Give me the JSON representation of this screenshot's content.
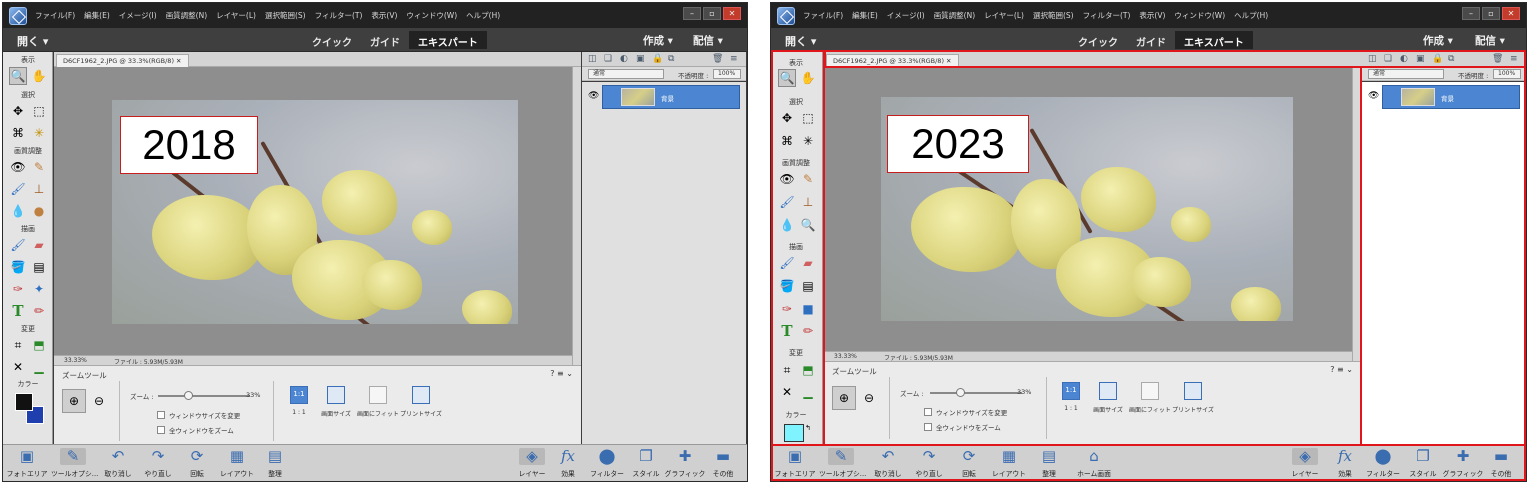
{
  "menu": [
    "ファイル(F)",
    "編集(E)",
    "イメージ(I)",
    "画質調整(N)",
    "レイヤー(L)",
    "選択範囲(S)",
    "フィルター(T)",
    "表示(V)",
    "ウィンドウ(W)",
    "ヘルプ(H)"
  ],
  "open_label": "開く",
  "modes": {
    "quick": "クイック",
    "guide": "ガイド",
    "expert": "エキスパート"
  },
  "create_label": "作成",
  "share_label": "配信",
  "doc_tab": "D6CF1962_2.JPG @ 33.3%(RGB/8)",
  "toolbox": {
    "view": "表示",
    "select": "選択",
    "enhance": "画質調整",
    "draw": "描画",
    "modify": "変更",
    "color": "カラー"
  },
  "icons": [
    "zoom-icon",
    "hand-icon",
    "move-icon",
    "marquee-icon",
    "lasso-icon",
    "magic-wand-icon",
    "red-eye-icon",
    "spot-healing-icon",
    "smart-brush-icon",
    "clone-stamp-icon",
    "blur-icon",
    "sponge-icon",
    "brush-icon",
    "eraser-icon",
    "paint-bucket-icon",
    "gradient-icon",
    "eyedropper-icon",
    "custom-shape-icon",
    "type-icon",
    "pencil-icon",
    "crop-icon",
    "recompose-icon",
    "content-aware-move-icon",
    "straighten-icon"
  ],
  "status": {
    "zoom": "33.33%",
    "file": "ファイル : 5.93M/5.93M"
  },
  "tool_options": {
    "title": "ズームツール",
    "zoom_label": "ズーム :",
    "zoom_value": "33%",
    "zoom_fraction": 0.33,
    "resize_windows": "ウィンドウサイズを変更",
    "zoom_all": "全ウィンドウをズーム",
    "btn_1to1": "1 : 1",
    "btn_1to1_icon": "1:1",
    "btn_view_size": "画面サイズ",
    "btn_fit": "画面にフィット",
    "btn_print_size": "プリントサイズ"
  },
  "layers": {
    "blend": "通常",
    "opacity_label": "不透明度 :",
    "opacity": "100%",
    "layer_name": "背景"
  },
  "bottom_left_2018": [
    "フォトエリア",
    "ツールオプシ...",
    "取り消し",
    "やり直し",
    "回転",
    "レイアウト",
    "整理"
  ],
  "bottom_left_2023": [
    "フォトエリア",
    "ツールオプシ...",
    "取り消し",
    "やり直し",
    "回転",
    "レイアウト",
    "整理",
    "ホーム画面"
  ],
  "bottom_right": [
    "レイヤー",
    "効果",
    "フィルター",
    "スタイル",
    "グラフィック",
    "その他"
  ],
  "years": {
    "left": "2018",
    "right": "2023"
  },
  "colors": {
    "highlight": "#e0161a",
    "active_blue": "#4c86d2",
    "fg_2018": "#111111",
    "bg_2018": "#1f3fae",
    "fg_2023": "#7ff3ff"
  }
}
